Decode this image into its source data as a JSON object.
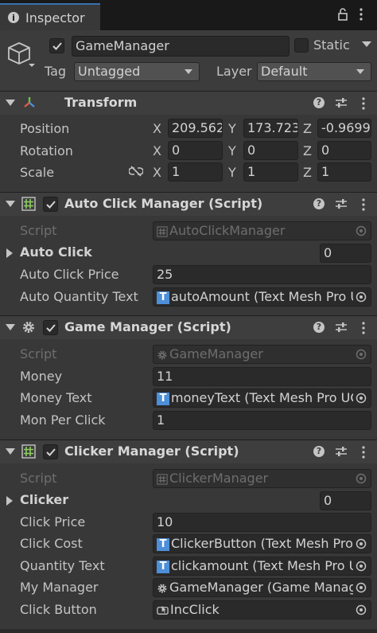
{
  "tab": {
    "label": "Inspector"
  },
  "gameobject": {
    "name": "GameManager",
    "static_label": "Static",
    "tag_label": "Tag",
    "tag_value": "Untagged",
    "layer_label": "Layer",
    "layer_value": "Default"
  },
  "transform": {
    "title": "Transform",
    "position_label": "Position",
    "rotation_label": "Rotation",
    "scale_label": "Scale",
    "axis_x": "X",
    "axis_y": "Y",
    "axis_z": "Z",
    "position": {
      "x": "209.562",
      "y": "173.723",
      "z": "-0.9699"
    },
    "rotation": {
      "x": "0",
      "y": "0",
      "z": "0"
    },
    "scale": {
      "x": "1",
      "y": "1",
      "z": "1"
    }
  },
  "auto_click_manager": {
    "title": "Auto Click Manager (Script)",
    "script_label": "Script",
    "script_value": "AutoClickManager",
    "auto_click_label": "Auto Click",
    "auto_click_count": "0",
    "auto_click_price_label": "Auto Click Price",
    "auto_click_price": "25",
    "auto_quantity_text_label": "Auto Quantity Text",
    "auto_quantity_text_value": "autoAmount (Text Mesh Pro U"
  },
  "game_manager": {
    "title": "Game Manager (Script)",
    "script_label": "Script",
    "script_value": "GameManager",
    "money_label": "Money",
    "money": "11",
    "money_text_label": "Money Text",
    "money_text_value": "moneyText (Text Mesh Pro UG",
    "mon_per_click_label": "Mon Per Click",
    "mon_per_click": "1"
  },
  "clicker_manager": {
    "title": "Clicker Manager (Script)",
    "script_label": "Script",
    "script_value": "ClickerManager",
    "clicker_label": "Clicker",
    "clicker_count": "0",
    "click_price_label": "Click Price",
    "click_price": "10",
    "click_cost_label": "Click Cost",
    "click_cost_value": "ClickerButton (Text Mesh Pro",
    "quantity_text_label": "Quantity Text",
    "quantity_text_value": "clickamount (Text Mesh Pro U",
    "my_manager_label": "My Manager",
    "my_manager_value": "GameManager (Game Manag",
    "click_button_label": "Click Button",
    "click_button_value": "IncClick"
  },
  "icons": {
    "tab": "info-icon",
    "lock": "lock-icon",
    "gameobject": "cube-icon",
    "transform": "transform-axes-icon",
    "script": "script-hash-icon",
    "gear": "gear-icon",
    "tmp": "text-mesh-pro-icon",
    "button": "button-icon"
  },
  "colors": {
    "background": "#383838",
    "header": "#3e3e3e",
    "field": "#2a2a2a",
    "text": "#c4c4c4",
    "tmp_blue": "#4d8fd8",
    "tab_accent": "#3a72b0"
  }
}
